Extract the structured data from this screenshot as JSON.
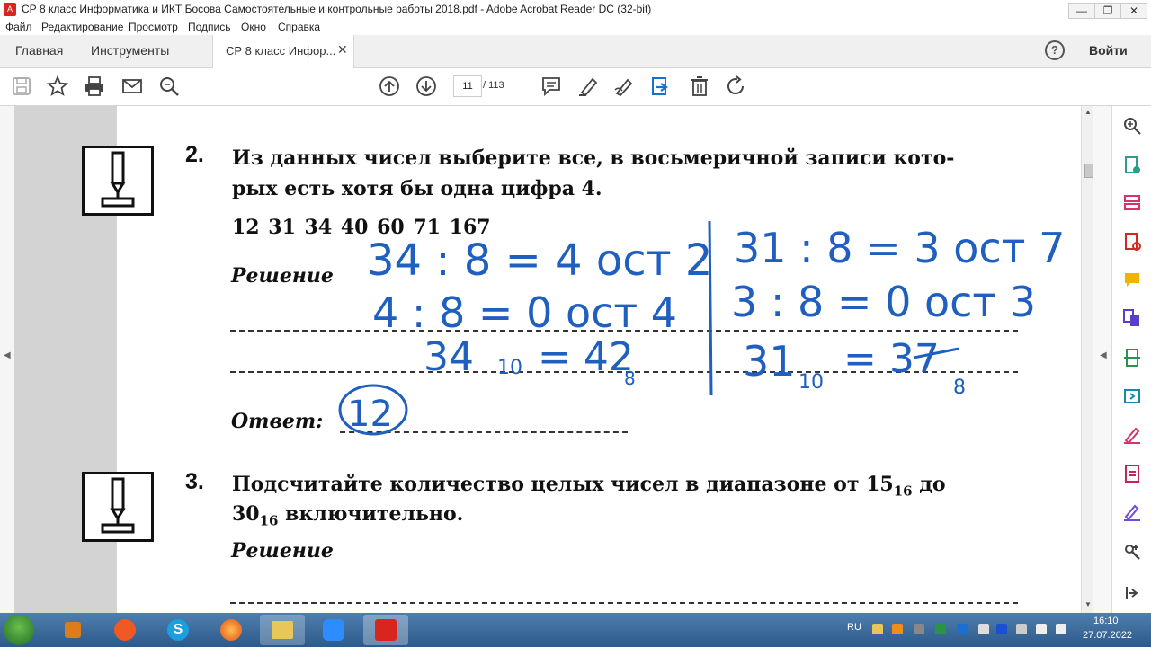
{
  "window": {
    "title": "СР 8 класс Информатика и ИКТ Босова Самостоятельные и контрольные работы 2018.pdf - Adobe Acrobat Reader DC (32-bit)",
    "app_icon_glyph": "A",
    "minimize": "—",
    "restore": "❐",
    "close": "✕"
  },
  "menu": [
    "Файл",
    "Редактирование",
    "Просмотр",
    "Подпись",
    "Окно",
    "Справка"
  ],
  "tabs": {
    "home": "Главная",
    "tools": "Инструменты",
    "document": "СР 8 класс Инфор...",
    "close_glyph": "✕",
    "help_glyph": "?",
    "sign_in": "Войти"
  },
  "toolbar": {
    "current_page": "11",
    "total_pages": "/ 113"
  },
  "document": {
    "task2": {
      "number": "2.",
      "line1": "Из данных чисел выберите все, в восьмеричной записи кото-",
      "line2": "рых есть хотя бы одна цифра 4.",
      "numbers": "12  31  34  40  60  71  167",
      "solution_label": "Решение",
      "answer_label": "Ответ:"
    },
    "task3": {
      "number": "3.",
      "line1_a": "Подсчитайте количество целых чисел в диапазоне от 15",
      "sub1": "16",
      "line1_b": " до",
      "line2_a": "30",
      "sub2": "16",
      "line2_b": " включительно.",
      "solution_label": "Решение"
    },
    "handwriting": {
      "color": "#1f5fbf",
      "l1": "34 : 8 = 4 ост 2",
      "l2": "4 : 8 = 0 ост 4",
      "l3": "34",
      "l3_sub": "10",
      "l3_eq": "= 42",
      "l3_sub8": "8",
      "r1": "31 : 8 = 3 ост 7",
      "r2": "3 : 8 = 0 ост 3",
      "r3": "31",
      "r3_sub": "10",
      "r3_eq": "= 37",
      "r3_sub8": "8",
      "answer": "12"
    }
  },
  "taskbar": {
    "lang": "RU",
    "time": "16:10",
    "date": "27.07.2022"
  },
  "colors": {
    "acrobat_red": "#d8261f",
    "ink_blue": "#1f5fbf",
    "taskbar": "#3a6a9a"
  }
}
